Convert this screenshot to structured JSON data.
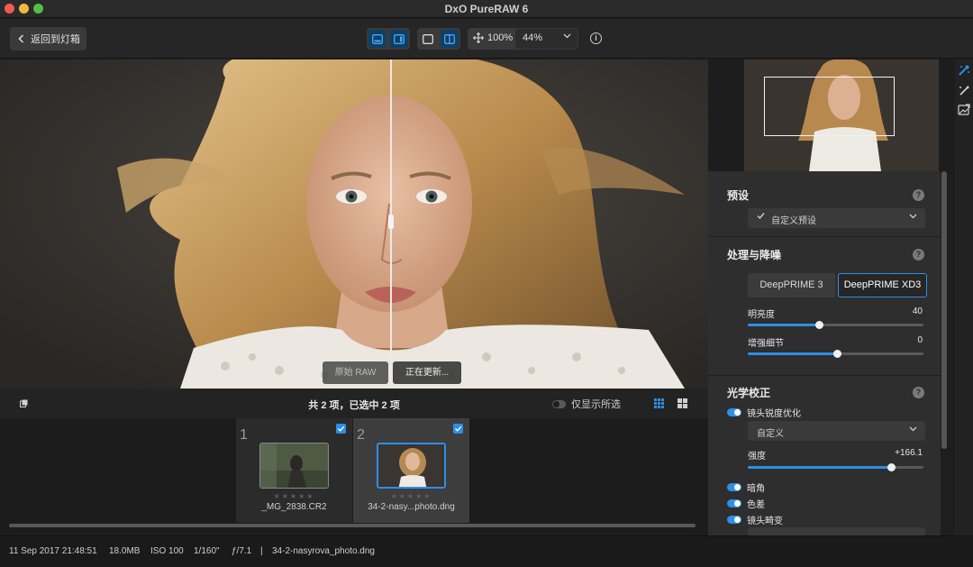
{
  "window": {
    "title": "DxO PureRAW 6"
  },
  "toolbar": {
    "back_label": "返回到灯箱",
    "zoom_fit": "100%",
    "zoom_value": "44%"
  },
  "viewer": {
    "label_original": "原始 RAW",
    "label_updating": "正在更新..."
  },
  "filmstrip": {
    "count_text": "共 2 项，已选中 2 项",
    "only_selected_label": "仅显示所选",
    "items": [
      {
        "index": "1",
        "filename": "_MG_2838.CR2",
        "stars": "★★★★★"
      },
      {
        "index": "2",
        "filename": "34-2-nasy...photo.dng",
        "stars": "★★★★★"
      }
    ]
  },
  "status": {
    "datetime": "11 Sep 2017 21:48:51",
    "size": "18.0MB",
    "iso": "ISO 100",
    "shutter": "1/160\"",
    "aperture": "ƒ/7.1",
    "separator": "|",
    "filename": "34-2-nasyrova_photo.dng"
  },
  "panel": {
    "preset": {
      "title": "预设",
      "help": "?",
      "value": "自定义预设"
    },
    "denoise": {
      "title": "处理与降噪",
      "help": "?",
      "btn_a": "DeepPRIME 3",
      "btn_b": "DeepPRIME XD3",
      "brightness_label": "明亮度",
      "brightness_value": "40",
      "brightness_fraction": 0.41,
      "detail_label": "增强细节",
      "detail_value": "0",
      "detail_fraction": 0.51
    },
    "optics": {
      "title": "光学校正",
      "help": "?",
      "sharpen_label": "镜头锐度优化",
      "mode_value": "自定义",
      "strength_label": "强度",
      "strength_value": "+166.1",
      "strength_fraction": 0.82,
      "vignette_label": "暗角",
      "chromatic_label": "色差",
      "distortion_label": "镜头畸变"
    }
  },
  "colors": {
    "accent": "#2d8fe6",
    "panel_bg": "#2e2e2e"
  }
}
